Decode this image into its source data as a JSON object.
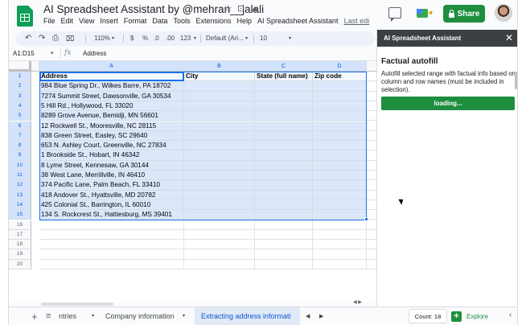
{
  "app": {
    "title": "AI Spreadsheet Assistant by @mehran__jalali",
    "menu": [
      "File",
      "Edit",
      "View",
      "Insert",
      "Format",
      "Data",
      "Tools",
      "Extensions",
      "Help",
      "AI Spreadsheet Assistant"
    ],
    "last_edit": "Last edi",
    "share_label": "Share",
    "star_icon": "☆",
    "move_icon": "⊡",
    "cloud_icon": "☁"
  },
  "toolbar": {
    "undo": "↶",
    "redo": "↷",
    "print": "⎙",
    "paint": "⌧",
    "zoom": "110%",
    "currency": "$",
    "percent": "%",
    "decrease_decimal": ".0",
    "increase_decimal": ".00",
    "number_format": "123",
    "font": "Default (Ari...",
    "font_size": "10"
  },
  "formula_bar": {
    "name_box": "A1:D15",
    "fx": "fx",
    "value": "Address"
  },
  "grid": {
    "columns": [
      "A",
      "B",
      "C",
      "D"
    ],
    "rows": [
      "1",
      "2",
      "3",
      "4",
      "5",
      "6",
      "7",
      "8",
      "9",
      "10",
      "11",
      "12",
      "13",
      "14",
      "15",
      "16",
      "17",
      "18",
      "19",
      "20"
    ],
    "cells": [
      [
        "Address",
        "City",
        "State (full name)",
        "Zip code"
      ],
      [
        "984 Blue Spring Dr., Wilkes Barre, PA 18702",
        "",
        "",
        ""
      ],
      [
        "7274 Summit Street, Dawsonville, GA 30534",
        "",
        "",
        ""
      ],
      [
        "5 Hill Rd., Hollywood, FL 33020",
        "",
        "",
        ""
      ],
      [
        "8289 Grove Avenue, Bemidji, MN 56601",
        "",
        "",
        ""
      ],
      [
        "12 Rockwell St., Mooresville, NC 28115",
        "",
        "",
        ""
      ],
      [
        "838 Green Street, Easley, SC 29640",
        "",
        "",
        ""
      ],
      [
        "653 N. Ashley Court, Greenville, NC 27834",
        "",
        "",
        ""
      ],
      [
        "1 Brookside St., Hobart, IN 46342",
        "",
        "",
        ""
      ],
      [
        "8 Lyme Street, Kennesaw, GA 30144",
        "",
        "",
        ""
      ],
      [
        "38 West Lane, Merrillville, IN 46410",
        "",
        "",
        ""
      ],
      [
        "374 Pacific Lane, Palm Beach, FL 33410",
        "",
        "",
        ""
      ],
      [
        "418 Andover St., Hyattsville, MD 20782",
        "",
        "",
        ""
      ],
      [
        "425 Colonial St., Barrington, IL 60010",
        "",
        "",
        ""
      ],
      [
        "134 S. Rockcrest St., Hattiesburg, MS 39401",
        "",
        "",
        ""
      ]
    ]
  },
  "sheets": {
    "add": "+",
    "all": "≡",
    "tabs": [
      "ntries",
      "Company information",
      "Extracting address informati"
    ],
    "tab_caret": "▾",
    "nav_left": "◀",
    "nav_right": "▶"
  },
  "status": {
    "count": "Count: 18",
    "explore": "Explore",
    "explore_icon": "+",
    "side_caret": "‹"
  },
  "panel": {
    "title": "AI Spreadsheet Assistant",
    "close": "✕",
    "heading": "Factual autofill",
    "description": "Autofill selected range with factual info based on column and row names (must be included in selection).",
    "button": "loading..."
  }
}
